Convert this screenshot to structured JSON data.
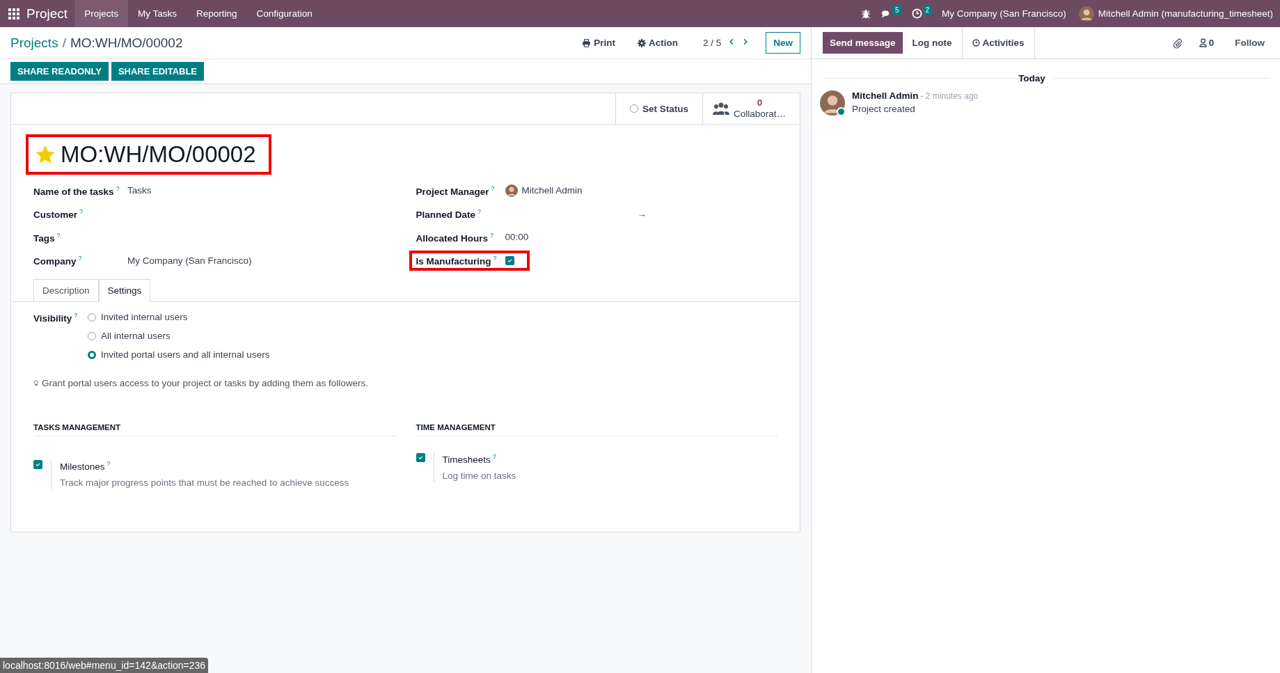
{
  "navbar": {
    "app_name": "Project",
    "menu": [
      {
        "label": "Projects",
        "selected": true
      },
      {
        "label": "My Tasks",
        "selected": false
      },
      {
        "label": "Reporting",
        "selected": false
      },
      {
        "label": "Configuration",
        "selected": false
      }
    ],
    "messages_count": "5",
    "activities_count": "2",
    "company": "My Company (San Francisco)",
    "user": "Mitchell Admin (manufacturing_timesheet)"
  },
  "breadcrumb": {
    "parent": "Projects",
    "separator": "/",
    "current": "MO:WH/MO/00002"
  },
  "actions": {
    "print": "Print",
    "action": "Action",
    "pager": "2 / 5",
    "new": "New"
  },
  "share_buttons": [
    "SHARE READONLY",
    "SHARE EDITABLE"
  ],
  "statusbar": {
    "set_status": "Set Status",
    "collaborators_count": "0",
    "collaborators_label": "Collaborat…"
  },
  "title": {
    "text": "MO:WH/MO/00002",
    "starred": true,
    "highlighted": true
  },
  "fields_left": [
    {
      "label": "Name of the tasks",
      "help": "?",
      "value": "Tasks"
    },
    {
      "label": "Customer",
      "help": "?"
    },
    {
      "label": "Tags",
      "help": "?"
    },
    {
      "label": "Company",
      "help": "?",
      "value": "My Company (San Francisco)"
    }
  ],
  "fields_right": [
    {
      "kind": "avatar",
      "label": "Project Manager",
      "help": "?",
      "value": "Mitchell Admin",
      "highlighted": false
    },
    {
      "kind": "daterange",
      "label": "Planned Date",
      "help": "?",
      "value": "→",
      "highlighted": false
    },
    {
      "kind": "text",
      "label": "Allocated Hours",
      "help": "?",
      "value": "00:00",
      "highlighted": false
    },
    {
      "kind": "checkbox",
      "label": "Is Manufacturing",
      "help": "?",
      "checked": true,
      "highlighted": true
    }
  ],
  "tabs": [
    {
      "label": "Description",
      "selected": false
    },
    {
      "label": "Settings",
      "selected": true
    }
  ],
  "visibility": {
    "label": "Visibility",
    "help": "?",
    "options": [
      {
        "label": "Invited internal users",
        "selected": false
      },
      {
        "label": "All internal users",
        "selected": false
      },
      {
        "label": "Invited portal users and all internal users",
        "selected": true
      }
    ]
  },
  "hint": "Grant portal users access to your project or tasks by adding them as followers.",
  "sections": [
    {
      "title": "TASKS MANAGEMENT",
      "items": [
        {
          "label": "Milestones",
          "help": "?",
          "description": "Track major progress points that must be reached to achieve success",
          "checked": true
        }
      ]
    },
    {
      "title": "TIME MANAGEMENT",
      "items": [
        {
          "label": "Timesheets",
          "help": "?",
          "description": "Log time on tasks",
          "checked": true
        }
      ]
    }
  ],
  "chatter": {
    "buttons": [
      {
        "label": "Send message",
        "selected": true
      },
      {
        "label": "Log note",
        "selected": false
      },
      {
        "label": "Activities",
        "selected": false
      }
    ],
    "followers_count": "0",
    "follow": "Follow",
    "date_separator": "Today",
    "messages": [
      {
        "author": "Mitchell Admin",
        "time": "- 2 minutes ago",
        "body": "Project created",
        "online": true
      }
    ]
  },
  "url_tooltip": "localhost:8016/web#menu_id=142&action=236"
}
